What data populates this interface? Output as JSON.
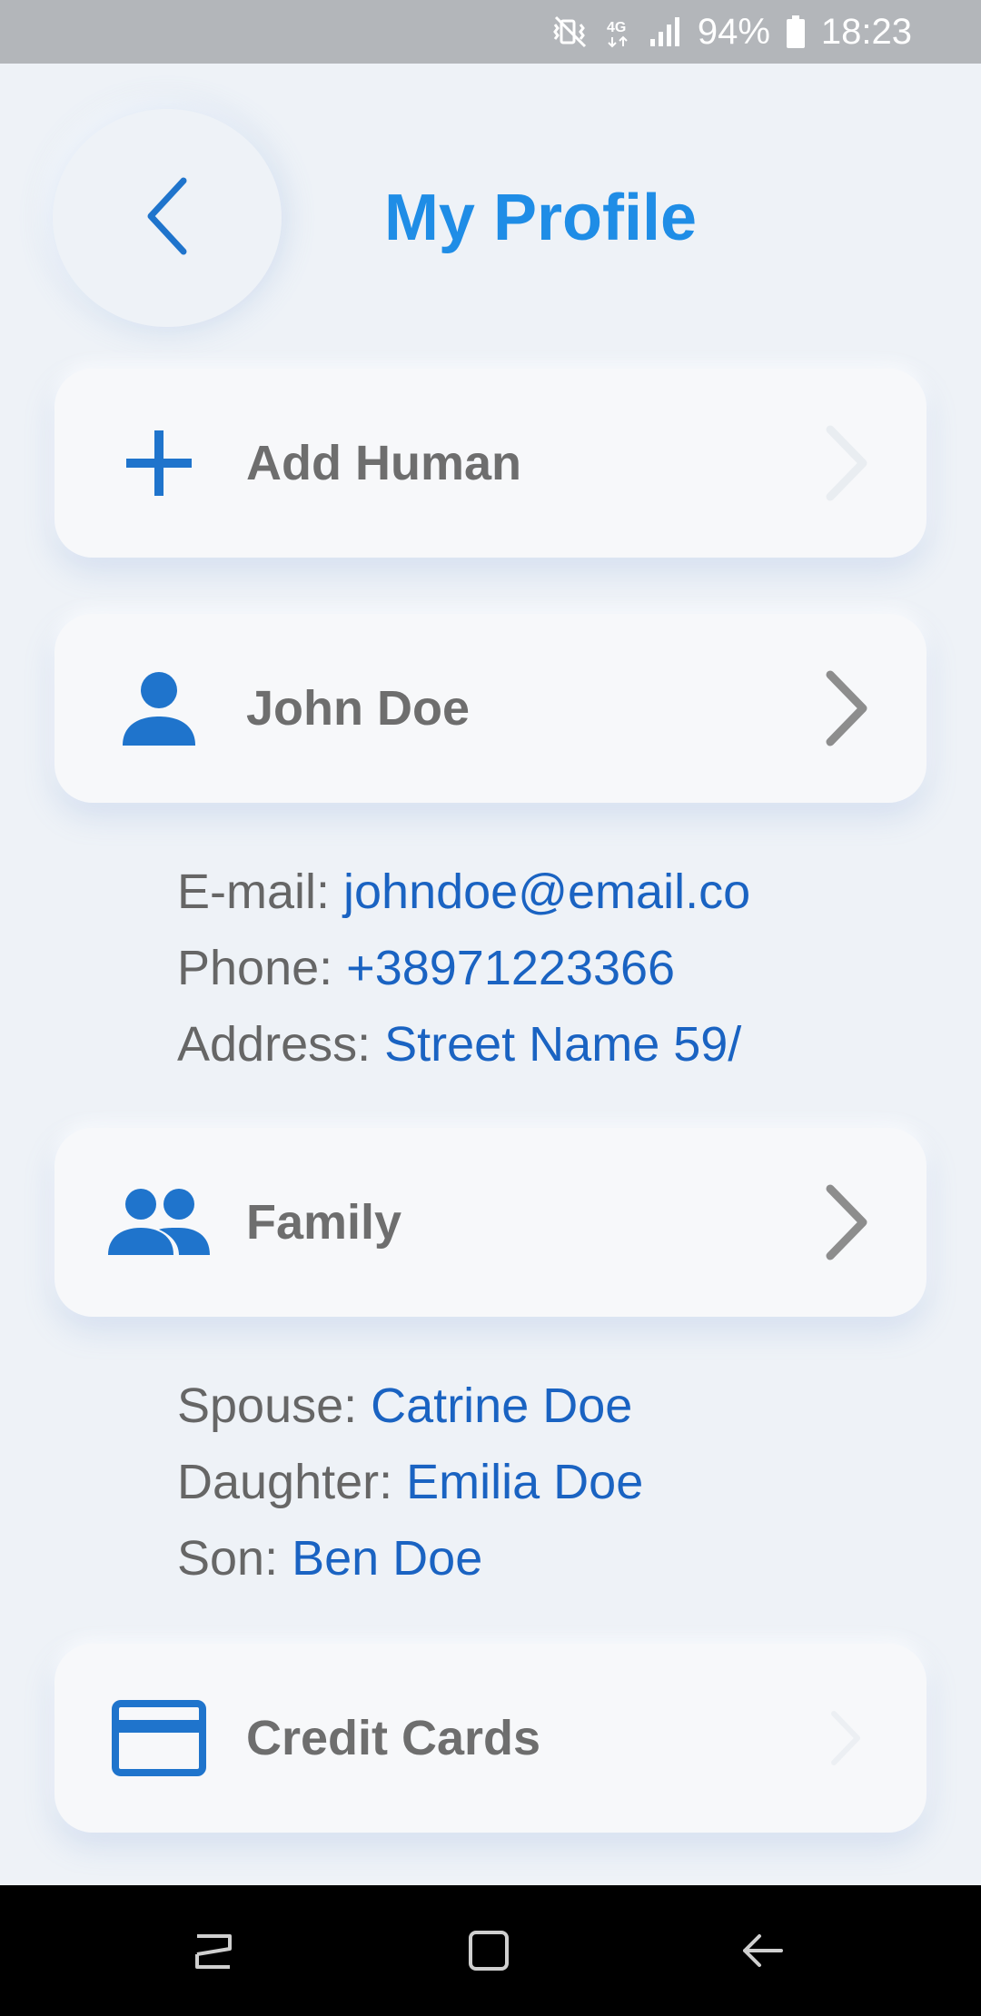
{
  "status_bar": {
    "battery_percent": "94%",
    "time": "18:23",
    "network_type": "4G",
    "icons": [
      "vibrate-mute-icon",
      "network-4g-icon",
      "signal-icon",
      "battery-icon"
    ]
  },
  "header": {
    "title": "My Profile",
    "back_icon": "chevron-left-icon"
  },
  "cards": {
    "add_human": {
      "label": "Add Human",
      "icon": "plus-icon"
    },
    "profile": {
      "label": "John Doe",
      "icon": "person-icon"
    },
    "family": {
      "label": "Family",
      "icon": "people-icon"
    },
    "credit_cards": {
      "label": "Credit Cards",
      "icon": "credit-card-icon"
    }
  },
  "profile_details": {
    "email_label": "E-mail: ",
    "email_value": "johndoe@email.co",
    "phone_label": "Phone: ",
    "phone_value": "+38971223366",
    "address_label": "Address: ",
    "address_value": "Street Name 59/"
  },
  "family_details": {
    "spouse_label": "Spouse: ",
    "spouse_value": "Catrine Doe",
    "daughter_label": "Daughter: ",
    "daughter_value": "Emilia Doe",
    "son_label": "Son: ",
    "son_value": "Ben Doe"
  },
  "colors": {
    "accent": "#1f8de6",
    "link_text": "#1a63c2",
    "label_text": "#6e6e6e",
    "background": "#eef2f7",
    "card": "#f7f8fa"
  },
  "nav_bar": {
    "icons": [
      "recent-apps-icon",
      "home-icon",
      "back-icon"
    ]
  }
}
